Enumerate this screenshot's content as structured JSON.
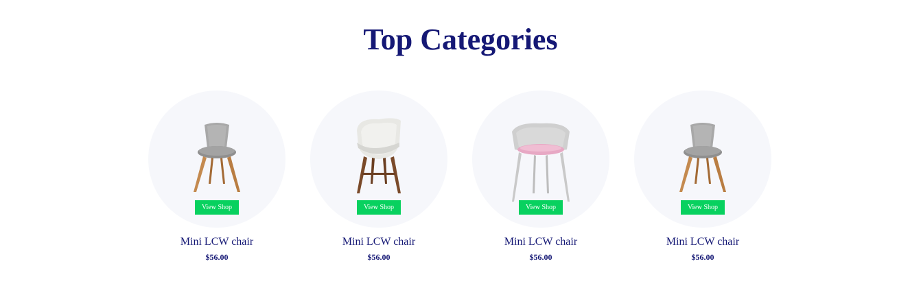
{
  "section": {
    "title": "Top Categories"
  },
  "products": [
    {
      "name": "Mini LCW chair",
      "price": "$56.00",
      "button": "View Shop",
      "image": "gray-wood-chair"
    },
    {
      "name": "Mini LCW chair",
      "price": "$56.00",
      "button": "View Shop",
      "image": "white-shell-chair"
    },
    {
      "name": "Mini LCW chair",
      "price": "$56.00",
      "button": "View Shop",
      "image": "gray-pink-armchair"
    },
    {
      "name": "Mini LCW chair",
      "price": "$56.00",
      "button": "View Shop",
      "image": "gray-wood-chair"
    }
  ],
  "colors": {
    "heading": "#151875",
    "button": "#08d15f",
    "circle": "#f6f7fb"
  }
}
